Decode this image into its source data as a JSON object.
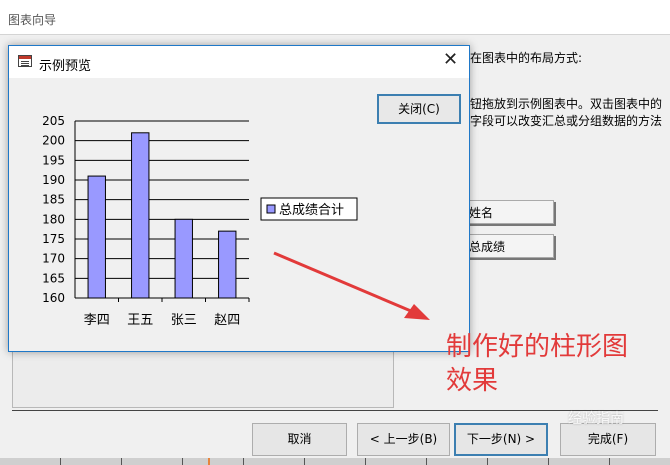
{
  "wizard": {
    "title": "图表向导",
    "instruction_line1": "在图表中的布局方式:",
    "instruction_line2": "钮拖放到示例图表中。双击图表中的",
    "instruction_line3": "字段可以改变汇总或分组数据的方法",
    "field_name": "姓名",
    "field_score": "总成绩",
    "buttons": {
      "cancel": "取消",
      "prev": "< 上一步(B)",
      "next": "下一步(N) >",
      "finish": "完成(F)"
    }
  },
  "dialog": {
    "title": "示例预览",
    "close_label": "关闭(C)",
    "close_glyph": "✕"
  },
  "chart_data": {
    "type": "bar",
    "categories": [
      "李四",
      "王五",
      "张三",
      "赵四"
    ],
    "series": [
      {
        "name": "总成绩合计",
        "values": [
          191,
          202,
          180,
          177
        ]
      }
    ],
    "ylim": [
      160,
      205
    ],
    "yticks": [
      205,
      200,
      195,
      190,
      185,
      180,
      175,
      170,
      165,
      160
    ],
    "grid": true,
    "legend_position": "right",
    "bar_color": "#9999ff"
  },
  "annotation": {
    "line1": "制作好的柱形图",
    "line2": "效果",
    "color": "#e23a3a"
  },
  "watermark": "经验指南"
}
